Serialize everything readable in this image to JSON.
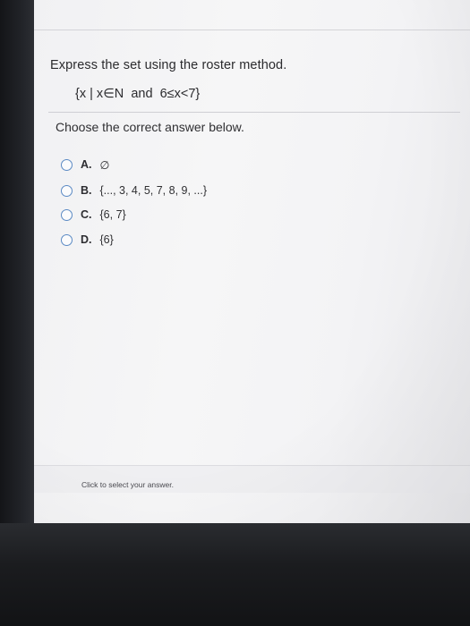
{
  "question": {
    "prompt": "Express the set using the roster method.",
    "set_expression": "{x | x∈N  and  6≤x<7}"
  },
  "instruction": "Choose the correct answer below.",
  "options": [
    {
      "letter": "A.",
      "text": "∅"
    },
    {
      "letter": "B.",
      "text": "{..., 3, 4, 5, 7, 8, 9, ...}"
    },
    {
      "letter": "C.",
      "text": "{6, 7}"
    },
    {
      "letter": "D.",
      "text": "{6}"
    }
  ],
  "footer": {
    "hint": "Click to select your answer."
  },
  "colors": {
    "radio_border": "#5b8ac4",
    "text": "#2b2b2e",
    "screen_bg": "#f4f4f6"
  }
}
